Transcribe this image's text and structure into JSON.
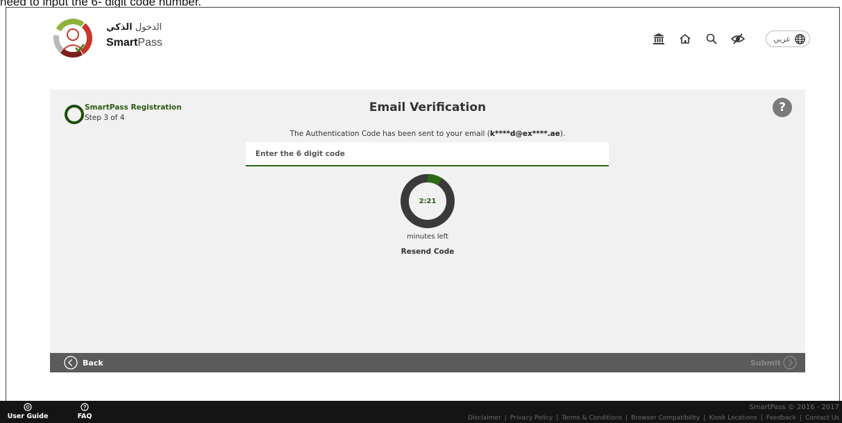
{
  "caption": "need to input the 6- digit code number.",
  "header": {
    "logo_ar_prefix": "الدخول ",
    "logo_ar_bold": "الذكي",
    "logo_en_bold": "Smart",
    "logo_en_rest": "Pass",
    "language_label": "عربي",
    "icons": [
      "government-icon",
      "home-icon",
      "search-icon",
      "eye-slash-icon",
      "globe-icon"
    ]
  },
  "step": {
    "title": "SmartPass Registration",
    "subtitle": "Step 3 of 4"
  },
  "main": {
    "title": "Email Verification",
    "help_label": "?",
    "info_prefix": "The Authentication Code has been sent to your email (",
    "info_email": "k****d@ex****.ae",
    "info_suffix": ").",
    "code_placeholder": "Enter the 6 digit code",
    "code_value": "",
    "timer_value": "2:21",
    "timer_fraction_remaining": 0.09,
    "minutes_left_label": "minutes left",
    "resend_label": "Resend Code"
  },
  "actions": {
    "back_label": "Back",
    "submit_label": "Submit"
  },
  "footer": {
    "user_guide_label": "User Guide",
    "faq_label": "FAQ",
    "copyright": "SmartPass © 2016 - 2017",
    "links": [
      "Disclaimer",
      "Privacy Policy",
      "Terms & Conditions",
      "Browser Compatibility",
      "Kiosk Locations",
      "Feedback",
      "Contact Us"
    ]
  },
  "colors": {
    "accent_green": "#2b6a12",
    "panel_bg": "#f1f1f1",
    "action_bar": "#5b5b5b",
    "footer_bg": "#141414"
  }
}
